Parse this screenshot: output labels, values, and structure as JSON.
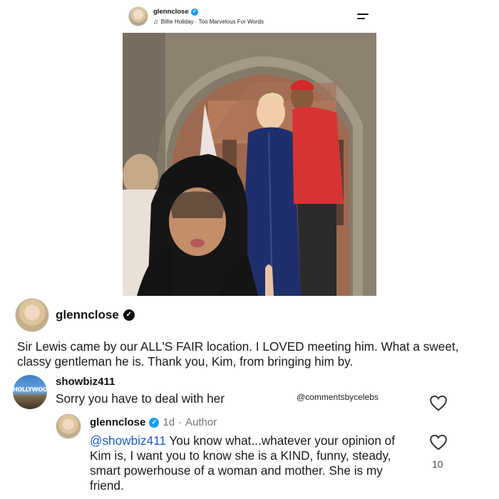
{
  "post": {
    "username": "glennclose",
    "music": "Billie Holiday · Too Marvelous For Words"
  },
  "caption": {
    "username": "glennclose",
    "text": "Sir Lewis came by our ALL'S FAIR location. I LOVED meeting him. What a sweet, classy gentleman he is. Thank you, Kim, from bringing him by."
  },
  "comments": [
    {
      "username": "showbiz411",
      "avatar_text": "HOLLYWOOD",
      "text": "Sorry you have to deal with her"
    }
  ],
  "reply": {
    "username": "glennclose",
    "time": "1d",
    "role": "Author",
    "mention": "@showbiz411",
    "text": " You know what...whatever your opinion of Kim is, I want you to know she is a KIND, funny, steady, smart powerhouse of a woman and mother. She is my friend.",
    "likes": "10"
  },
  "watermark": "@commentsbycelebs",
  "icons": {
    "verified": "verified-badge-icon",
    "music": "music-note-icon",
    "menu": "menu-icon",
    "like": "heart-icon"
  },
  "colors": {
    "verified_blue": "#1d9bf0",
    "mention": "#1e5bbf"
  }
}
